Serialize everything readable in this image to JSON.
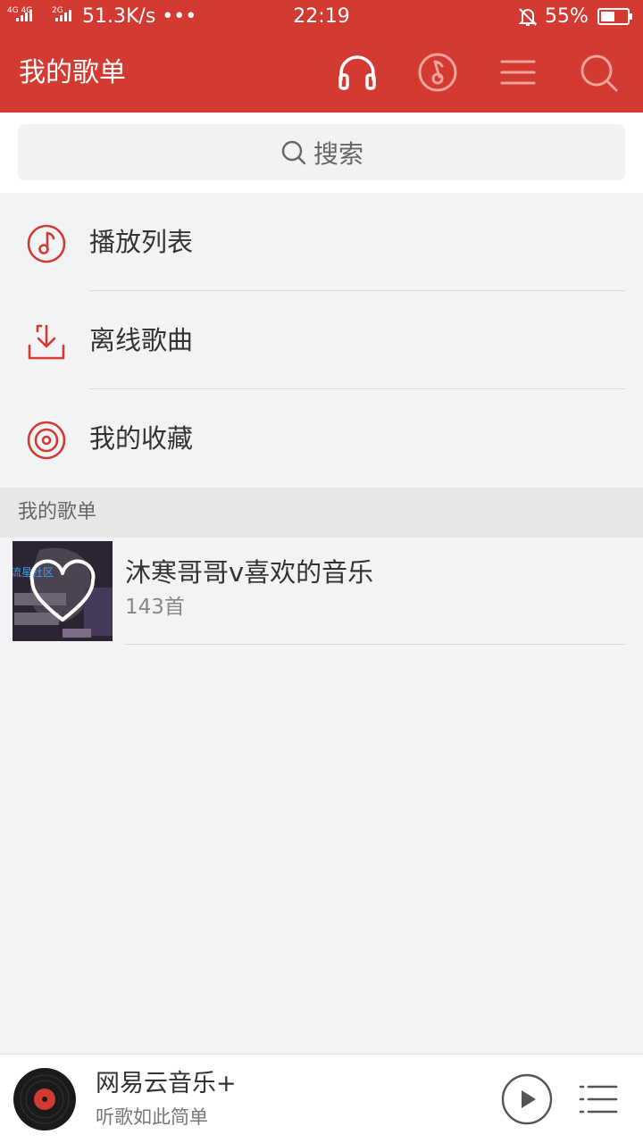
{
  "status_bar": {
    "sim1_label": "4G 4G",
    "sim2_label": "2G",
    "net_speed": "51.3K/s •••",
    "time": "22:19",
    "battery_percent": "55%",
    "battery_level": 0.55,
    "icons": [
      "signal-icon",
      "signal-icon",
      "bell-muted-icon",
      "battery-icon"
    ]
  },
  "header": {
    "title": "我的歌单",
    "icons": [
      "headphones-icon",
      "music-note-icon",
      "menu-icon",
      "search-icon"
    ]
  },
  "search": {
    "placeholder": "搜索",
    "icon": "search-icon"
  },
  "menu": [
    {
      "label": "播放列表",
      "icon": "music-note-circle-icon"
    },
    {
      "label": "离线歌曲",
      "icon": "download-icon"
    },
    {
      "label": "我的收藏",
      "icon": "disc-icon"
    }
  ],
  "section": {
    "title": "我的歌单"
  },
  "playlists": [
    {
      "name": "沐寒哥哥v喜欢的音乐",
      "count": "143首",
      "cover_tag": "流星社区",
      "icon": "heart-icon"
    }
  ],
  "player": {
    "title": "网易云音乐+",
    "subtitle": "听歌如此简单",
    "icons": [
      "vinyl-disc-icon",
      "play-icon",
      "playlist-icon"
    ]
  },
  "colors": {
    "brand": "#d33a31",
    "background": "#f2f3f5",
    "text": "#333333",
    "muted": "#888888"
  }
}
